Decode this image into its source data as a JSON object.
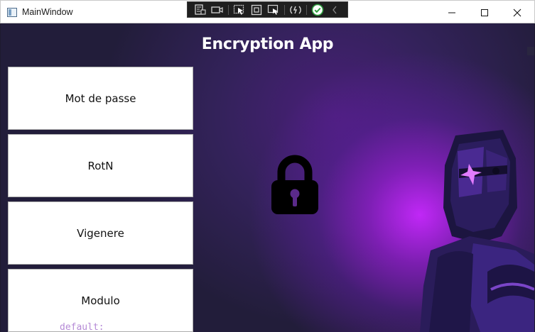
{
  "window": {
    "title": "MainWindow",
    "controls": {
      "minimize": "minimize-icon",
      "maximize": "maximize-icon",
      "close": "close-icon"
    }
  },
  "debug_toolbar": {
    "items": [
      "live-visual-tree-icon",
      "record-icon",
      "select-element-icon",
      "display-layout-adorners-icon",
      "track-focus-icon",
      "hot-reload-icon",
      "check-icon",
      "collapse-chevron-icon"
    ]
  },
  "app": {
    "title": "Encryption App",
    "buttons": [
      {
        "label": "Mot de passe"
      },
      {
        "label": "RotN"
      },
      {
        "label": "Vigenere"
      },
      {
        "label": "Modulo"
      }
    ],
    "code_peek": "default:",
    "images": [
      "lock-icon",
      "knight-illustration"
    ]
  },
  "colors": {
    "background_dark": "#221d3a",
    "glow_purple": "#c828ff",
    "button_bg": "#ffffff",
    "title_text": "#ffffff"
  }
}
